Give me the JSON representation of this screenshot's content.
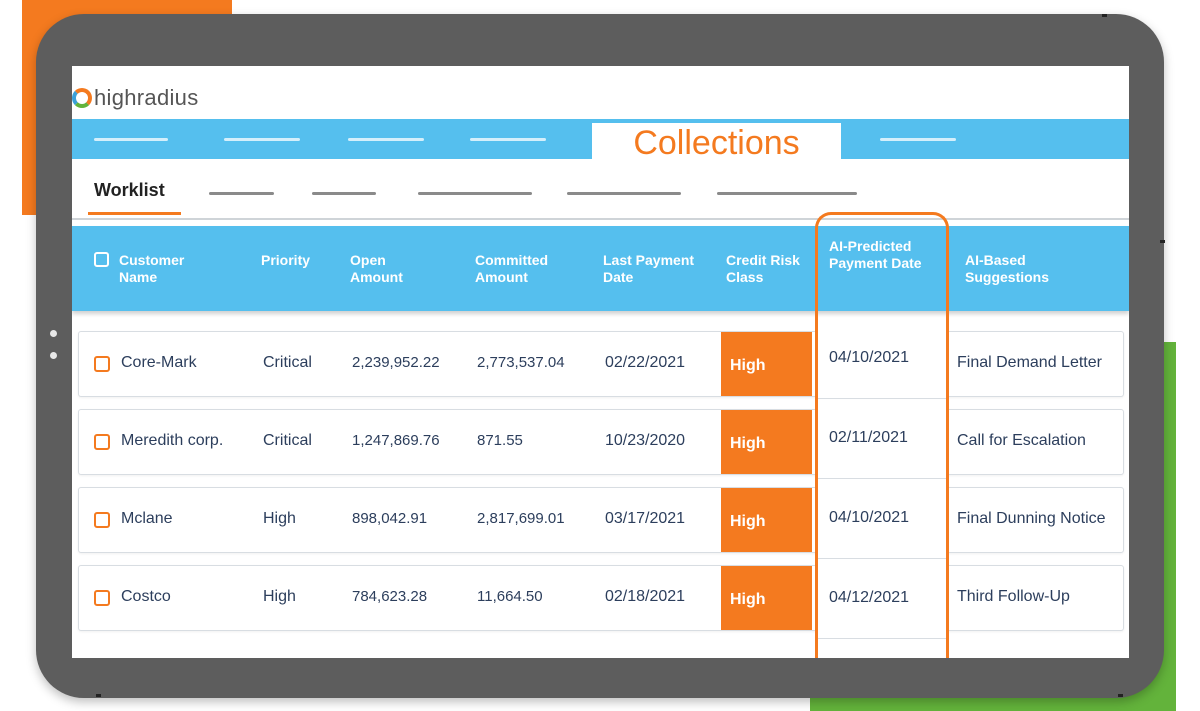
{
  "app": {
    "logo_text": "highradius",
    "title": "Collections",
    "active_subtab": "Worklist"
  },
  "colors": {
    "brand_orange": "#f47a1f",
    "header_blue": "#55bfee",
    "accent_green": "#63b33b",
    "device_gray": "#5d5d5d",
    "text_navy": "#2c3e5c"
  },
  "table": {
    "columns": [
      "Customer Name",
      "Priority",
      "Open Amount",
      "Committed Amount",
      "Last Payment Date",
      "Credit Risk Class",
      "AI-Predicted Payment Date",
      "AI-Based Suggestions"
    ],
    "rows": [
      {
        "customer": "Core-Mark",
        "priority": "Critical",
        "open_amount": "2,239,952.22",
        "committed_amount": "2,773,537.04",
        "last_payment": "02/22/2021",
        "risk": "High",
        "ai_date": "04/10/2021",
        "suggestion": "Final Demand Letter"
      },
      {
        "customer": "Meredith corp.",
        "priority": "Critical",
        "open_amount": "1,247,869.76",
        "committed_amount": "871.55",
        "last_payment": "10/23/2020",
        "risk": "High",
        "ai_date": "02/11/2021",
        "suggestion": "Call for Escalation"
      },
      {
        "customer": "Mclane",
        "priority": "High",
        "open_amount": "898,042.91",
        "committed_amount": "2,817,699.01",
        "last_payment": "03/17/2021",
        "risk": "High",
        "ai_date": "04/10/2021",
        "suggestion": "Final Dunning Notice"
      },
      {
        "customer": "Costco",
        "priority": "High",
        "open_amount": "784,623.28",
        "committed_amount": "11,664.50",
        "last_payment": "02/18/2021",
        "risk": "High",
        "ai_date": "04/12/2021",
        "suggestion": "Third Follow-Up"
      }
    ]
  }
}
